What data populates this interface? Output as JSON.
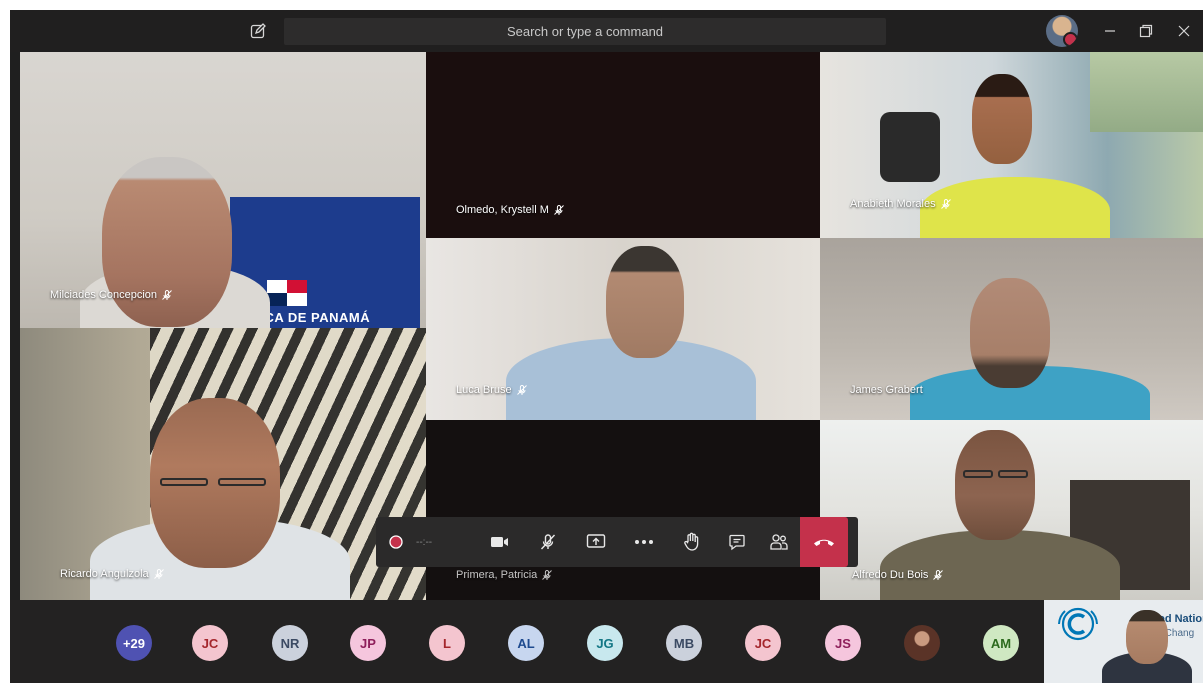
{
  "titlebar": {
    "search_placeholder": "Search or type a command"
  },
  "participants": {
    "milciades": "Milciades Concepcion",
    "olmedo": "Olmedo, Krystell M",
    "anabieth": "Anabieth Morales",
    "luca": "Luca Bruse",
    "james": "James Grabert",
    "ricardo": "Ricardo Angulzola",
    "primera": "Primera, Patricia",
    "alfredo": "Alfredo Du Bois"
  },
  "backgrounds": {
    "flag_sign": "BLICA DE PANAMÁ"
  },
  "controls": {
    "timer": "--:--"
  },
  "roster": {
    "overflow": "+29",
    "avatars": [
      {
        "initials": "JC"
      },
      {
        "initials": "NR"
      },
      {
        "initials": "JP"
      },
      {
        "initials": "L"
      },
      {
        "initials": "AL"
      },
      {
        "initials": "JG"
      },
      {
        "initials": "MB"
      },
      {
        "initials": "JC"
      },
      {
        "initials": "JS"
      },
      {
        "initials": "AM"
      }
    ],
    "unfccc_text_1": "ited Natior",
    "unfccc_text_2": "ate Chang"
  },
  "colors": {
    "hangup": "#c4314b",
    "overflow_avatar": "#4f52b2",
    "record_dot": "#c4314b"
  }
}
